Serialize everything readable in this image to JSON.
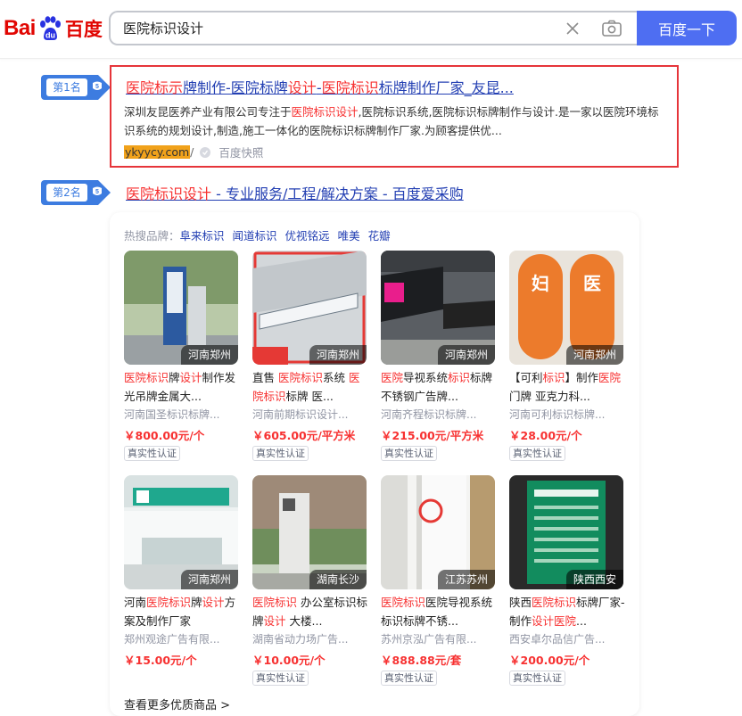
{
  "header": {
    "logo_bai": "Bai",
    "logo_du": "du",
    "logo_cn": "百度",
    "search_value": "医院标识设计",
    "search_button": "百度一下"
  },
  "results": [
    {
      "rank": "第1名",
      "title_parts": [
        {
          "t": "医院标示",
          "hl": true
        },
        {
          "t": "牌制作-医院标牌",
          "hl": false
        },
        {
          "t": "设计",
          "hl": true
        },
        {
          "t": "-",
          "hl": false
        },
        {
          "t": "医院标识",
          "hl": true
        },
        {
          "t": "标牌制作厂家_友昆...",
          "hl": false
        }
      ],
      "abstract_parts": [
        {
          "t": "深圳友昆医养产业有限公司专注于",
          "hl": false
        },
        {
          "t": "医院标识设计",
          "hl": true
        },
        {
          "t": ",医院标识系统,医院标识标牌制作与设计.是一家以医院环境标识系统的规划设计,制造,施工一体化的医院标识标牌制作厂家.为顾客提供优...",
          "hl": false
        }
      ],
      "site": "ykyycy.com",
      "slash": "/",
      "snapshot": "百度快照"
    },
    {
      "rank": "第2名",
      "title_parts": [
        {
          "t": "医院标识设计",
          "hl": true
        },
        {
          "t": " - 专业服务/工程/解决方案 - 百度爱采购",
          "hl": false
        }
      ]
    }
  ],
  "goods": {
    "brands_label": "热搜品牌：",
    "brands": [
      "阜来标识",
      "闻道标识",
      "优视铭远",
      "唯美",
      "花瓣"
    ],
    "badge": "真实性认证",
    "more_label": "查看更多优质商品 >",
    "items": [
      {
        "loc": "河南郑州",
        "title_parts": [
          {
            "t": "医院标识",
            "hl": true
          },
          {
            "t": "牌",
            "hl": false
          },
          {
            "t": "设计",
            "hl": true
          },
          {
            "t": "制作发光吊牌金属大...",
            "hl": false
          }
        ],
        "shop": "河南国圣标识标牌...",
        "price": "￥800.00元/个",
        "badge": true
      },
      {
        "loc": "河南郑州",
        "title_parts": [
          {
            "t": "直售 ",
            "hl": false
          },
          {
            "t": "医院标识",
            "hl": true
          },
          {
            "t": "系统 ",
            "hl": false
          },
          {
            "t": "医院标识",
            "hl": true
          },
          {
            "t": "标牌 医...",
            "hl": false
          }
        ],
        "shop": "河南前期标识设计...",
        "price": "￥605.00元/平方米",
        "badge": true
      },
      {
        "loc": "河南郑州",
        "title_parts": [
          {
            "t": "医院",
            "hl": true
          },
          {
            "t": "导视系统",
            "hl": false
          },
          {
            "t": "标识",
            "hl": true
          },
          {
            "t": "标牌 不锈钢广告牌...",
            "hl": false
          }
        ],
        "shop": "河南齐程标识标牌...",
        "price": "￥215.00元/平方米",
        "badge": true
      },
      {
        "loc": "河南郑州",
        "title_parts": [
          {
            "t": "【可利",
            "hl": false
          },
          {
            "t": "标识",
            "hl": true
          },
          {
            "t": "】制作",
            "hl": false
          },
          {
            "t": "医院",
            "hl": true
          },
          {
            "t": "门牌 亚克力科...",
            "hl": false
          }
        ],
        "shop": "河南可利标识标牌...",
        "price": "￥28.00元/个",
        "badge": true
      },
      {
        "loc": "河南郑州",
        "title_parts": [
          {
            "t": "河南",
            "hl": false
          },
          {
            "t": "医院标识",
            "hl": true
          },
          {
            "t": "牌",
            "hl": false
          },
          {
            "t": "设计",
            "hl": true
          },
          {
            "t": "方案及制作厂家",
            "hl": false
          }
        ],
        "shop": "郑州观途广告有限...",
        "price": "￥15.00元/个",
        "badge": false
      },
      {
        "loc": "湖南长沙",
        "title_parts": [
          {
            "t": "医院标识",
            "hl": true
          },
          {
            "t": " 办公室标识标牌",
            "hl": false
          },
          {
            "t": "设计",
            "hl": true
          },
          {
            "t": " 大楼...",
            "hl": false
          }
        ],
        "shop": "湖南省动力场广告...",
        "price": "￥10.00元/个",
        "badge": true
      },
      {
        "loc": "江苏苏州",
        "title_parts": [
          {
            "t": "医院标识",
            "hl": true
          },
          {
            "t": "医院导视系统标识标牌不锈...",
            "hl": false
          }
        ],
        "shop": "苏州京泓广告有限...",
        "price": "￥888.88元/套",
        "badge": true
      },
      {
        "loc": "陕西西安",
        "title_parts": [
          {
            "t": "陕西",
            "hl": false
          },
          {
            "t": "医院标识",
            "hl": true
          },
          {
            "t": "标牌厂家-制作",
            "hl": false
          },
          {
            "t": "设计医院",
            "hl": true
          },
          {
            "t": "...",
            "hl": false
          }
        ],
        "shop": "西安卓尔品信广告...",
        "price": "￥200.00元/个",
        "badge": true
      }
    ]
  }
}
